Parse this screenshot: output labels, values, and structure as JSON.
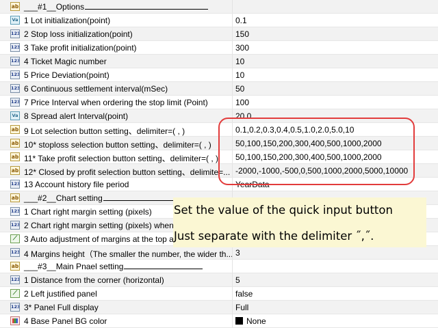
{
  "rows": [
    {
      "icon": "text-icon",
      "glyph": "ab",
      "kind": "ab",
      "label": "___#1__Options",
      "fill": 180,
      "value": ""
    },
    {
      "icon": "double-value-icon",
      "glyph": "Va",
      "kind": "va",
      "label": "1 Lot initialization(point)",
      "value": "0.1"
    },
    {
      "icon": "integer-icon",
      "glyph": "123",
      "kind": "num",
      "label": "2 Stop loss initialization(point)",
      "value": "150"
    },
    {
      "icon": "integer-icon",
      "glyph": "123",
      "kind": "num",
      "label": "3 Take profit initialization(point)",
      "value": "300"
    },
    {
      "icon": "integer-icon",
      "glyph": "123",
      "kind": "num",
      "label": "4 Ticket Magic number",
      "value": "10"
    },
    {
      "icon": "integer-icon",
      "glyph": "123",
      "kind": "num",
      "label": "5 Price Deviation(point)",
      "value": "10"
    },
    {
      "icon": "integer-icon",
      "glyph": "123",
      "kind": "num",
      "label": "6 Continuous settlement interval(mSec)",
      "value": "50"
    },
    {
      "icon": "integer-icon",
      "glyph": "123",
      "kind": "num",
      "label": "7 Price Interval when ordering the stop limit (Point)",
      "value": "100"
    },
    {
      "icon": "double-value-icon",
      "glyph": "Va",
      "kind": "va",
      "label": "8 Spread alert Interval(point)",
      "value": "20.0"
    },
    {
      "icon": "text-icon",
      "glyph": "ab",
      "kind": "ab",
      "label": "9 Lot selection button setting、delimiter=( , )",
      "value": "0.1,0.2,0.3,0.4,0.5,1.0,2.0,5.0,10"
    },
    {
      "icon": "text-icon",
      "glyph": "ab",
      "kind": "ab",
      "label": "10* stoploss selection button setting、delimiter=( , )",
      "value": "50,100,150,200,300,400,500,1000,2000"
    },
    {
      "icon": "text-icon",
      "glyph": "ab",
      "kind": "ab",
      "label": "11* Take profit selection button setting、delimiter=( , )",
      "value": "50,100,150,200,300,400,500,1000,2000"
    },
    {
      "icon": "text-icon",
      "glyph": "ab",
      "kind": "ab",
      "label": "12* Closed by profit selection button setting、delimite=...",
      "value": "-2000,-1000,-500,0,500,1000,2000,5000,10000"
    },
    {
      "icon": "integer-icon",
      "glyph": "123",
      "kind": "num",
      "label": "13 Account history file period",
      "value": "YearData"
    },
    {
      "icon": "text-icon",
      "glyph": "ab",
      "kind": "ab",
      "label": "___#2__Chart setting",
      "fill": 130,
      "value": ""
    },
    {
      "icon": "integer-icon",
      "glyph": "123",
      "kind": "num",
      "label": "1 Chart right margin setting (pixels)",
      "value": ""
    },
    {
      "icon": "integer-icon",
      "glyph": "123",
      "kind": "num",
      "label": "2 Chart right margin setting (pixels) when",
      "value": ""
    },
    {
      "icon": "chart-icon",
      "glyph": "⟋",
      "kind": "chart",
      "label": "3 Auto adjustment of margins at the top a",
      "value": ""
    },
    {
      "icon": "integer-icon",
      "glyph": "123",
      "kind": "num",
      "label": "4 Margins height（The smaller the number, the wider th...",
      "value": "3"
    },
    {
      "icon": "text-icon",
      "glyph": "ab",
      "kind": "ab",
      "label": "___#3__Main Pnael setting",
      "fill": 115,
      "value": ""
    },
    {
      "icon": "integer-icon",
      "glyph": "123",
      "kind": "num",
      "label": "1 Distance from the corner (horizontal)",
      "value": "5"
    },
    {
      "icon": "chart-icon",
      "glyph": "⟋",
      "kind": "chart",
      "label": "2 Left justified panel",
      "value": "false"
    },
    {
      "icon": "integer-icon",
      "glyph": "123",
      "kind": "num",
      "label": "3* Panel Full display",
      "value": "Full"
    },
    {
      "icon": "color-icon",
      "glyph": "",
      "kind": "color",
      "label": "4 Base Panel BG color",
      "value": "None",
      "swatch": "#000000"
    }
  ],
  "tooltip": {
    "line1": "Set the value of the quick input button",
    "line2": "Just separate with the delimiter ˝,˝."
  },
  "colors": {
    "highlight_outline": "#e23b3b",
    "tooltip_bg": "#fbf7d3"
  }
}
